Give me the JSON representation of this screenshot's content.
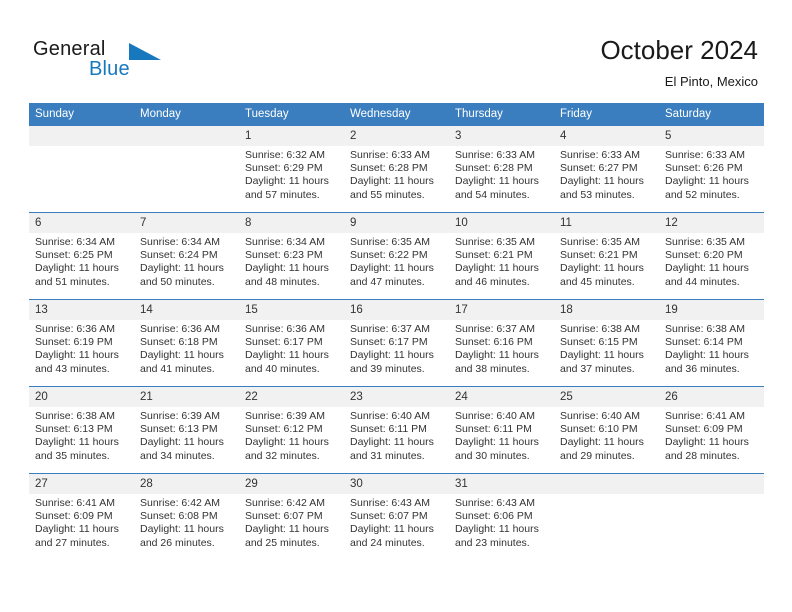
{
  "logo": {
    "word_general": "General",
    "word_blue": "Blue",
    "accent_color": "#1878be"
  },
  "header": {
    "title": "October 2024",
    "subtitle": "El Pinto, Mexico"
  },
  "calendar": {
    "header_bg": "#3a7ebf",
    "daynum_bg": "#f1f1f1",
    "weekdays": [
      "Sunday",
      "Monday",
      "Tuesday",
      "Wednesday",
      "Thursday",
      "Friday",
      "Saturday"
    ],
    "weeks": [
      [
        {
          "day": "",
          "sunrise": "",
          "sunset": "",
          "daylight_line1": "",
          "daylight_line2": ""
        },
        {
          "day": "",
          "sunrise": "",
          "sunset": "",
          "daylight_line1": "",
          "daylight_line2": ""
        },
        {
          "day": "1",
          "sunrise": "Sunrise: 6:32 AM",
          "sunset": "Sunset: 6:29 PM",
          "daylight_line1": "Daylight: 11 hours",
          "daylight_line2": "and 57 minutes."
        },
        {
          "day": "2",
          "sunrise": "Sunrise: 6:33 AM",
          "sunset": "Sunset: 6:28 PM",
          "daylight_line1": "Daylight: 11 hours",
          "daylight_line2": "and 55 minutes."
        },
        {
          "day": "3",
          "sunrise": "Sunrise: 6:33 AM",
          "sunset": "Sunset: 6:28 PM",
          "daylight_line1": "Daylight: 11 hours",
          "daylight_line2": "and 54 minutes."
        },
        {
          "day": "4",
          "sunrise": "Sunrise: 6:33 AM",
          "sunset": "Sunset: 6:27 PM",
          "daylight_line1": "Daylight: 11 hours",
          "daylight_line2": "and 53 minutes."
        },
        {
          "day": "5",
          "sunrise": "Sunrise: 6:33 AM",
          "sunset": "Sunset: 6:26 PM",
          "daylight_line1": "Daylight: 11 hours",
          "daylight_line2": "and 52 minutes."
        }
      ],
      [
        {
          "day": "6",
          "sunrise": "Sunrise: 6:34 AM",
          "sunset": "Sunset: 6:25 PM",
          "daylight_line1": "Daylight: 11 hours",
          "daylight_line2": "and 51 minutes."
        },
        {
          "day": "7",
          "sunrise": "Sunrise: 6:34 AM",
          "sunset": "Sunset: 6:24 PM",
          "daylight_line1": "Daylight: 11 hours",
          "daylight_line2": "and 50 minutes."
        },
        {
          "day": "8",
          "sunrise": "Sunrise: 6:34 AM",
          "sunset": "Sunset: 6:23 PM",
          "daylight_line1": "Daylight: 11 hours",
          "daylight_line2": "and 48 minutes."
        },
        {
          "day": "9",
          "sunrise": "Sunrise: 6:35 AM",
          "sunset": "Sunset: 6:22 PM",
          "daylight_line1": "Daylight: 11 hours",
          "daylight_line2": "and 47 minutes."
        },
        {
          "day": "10",
          "sunrise": "Sunrise: 6:35 AM",
          "sunset": "Sunset: 6:21 PM",
          "daylight_line1": "Daylight: 11 hours",
          "daylight_line2": "and 46 minutes."
        },
        {
          "day": "11",
          "sunrise": "Sunrise: 6:35 AM",
          "sunset": "Sunset: 6:21 PM",
          "daylight_line1": "Daylight: 11 hours",
          "daylight_line2": "and 45 minutes."
        },
        {
          "day": "12",
          "sunrise": "Sunrise: 6:35 AM",
          "sunset": "Sunset: 6:20 PM",
          "daylight_line1": "Daylight: 11 hours",
          "daylight_line2": "and 44 minutes."
        }
      ],
      [
        {
          "day": "13",
          "sunrise": "Sunrise: 6:36 AM",
          "sunset": "Sunset: 6:19 PM",
          "daylight_line1": "Daylight: 11 hours",
          "daylight_line2": "and 43 minutes."
        },
        {
          "day": "14",
          "sunrise": "Sunrise: 6:36 AM",
          "sunset": "Sunset: 6:18 PM",
          "daylight_line1": "Daylight: 11 hours",
          "daylight_line2": "and 41 minutes."
        },
        {
          "day": "15",
          "sunrise": "Sunrise: 6:36 AM",
          "sunset": "Sunset: 6:17 PM",
          "daylight_line1": "Daylight: 11 hours",
          "daylight_line2": "and 40 minutes."
        },
        {
          "day": "16",
          "sunrise": "Sunrise: 6:37 AM",
          "sunset": "Sunset: 6:17 PM",
          "daylight_line1": "Daylight: 11 hours",
          "daylight_line2": "and 39 minutes."
        },
        {
          "day": "17",
          "sunrise": "Sunrise: 6:37 AM",
          "sunset": "Sunset: 6:16 PM",
          "daylight_line1": "Daylight: 11 hours",
          "daylight_line2": "and 38 minutes."
        },
        {
          "day": "18",
          "sunrise": "Sunrise: 6:38 AM",
          "sunset": "Sunset: 6:15 PM",
          "daylight_line1": "Daylight: 11 hours",
          "daylight_line2": "and 37 minutes."
        },
        {
          "day": "19",
          "sunrise": "Sunrise: 6:38 AM",
          "sunset": "Sunset: 6:14 PM",
          "daylight_line1": "Daylight: 11 hours",
          "daylight_line2": "and 36 minutes."
        }
      ],
      [
        {
          "day": "20",
          "sunrise": "Sunrise: 6:38 AM",
          "sunset": "Sunset: 6:13 PM",
          "daylight_line1": "Daylight: 11 hours",
          "daylight_line2": "and 35 minutes."
        },
        {
          "day": "21",
          "sunrise": "Sunrise: 6:39 AM",
          "sunset": "Sunset: 6:13 PM",
          "daylight_line1": "Daylight: 11 hours",
          "daylight_line2": "and 34 minutes."
        },
        {
          "day": "22",
          "sunrise": "Sunrise: 6:39 AM",
          "sunset": "Sunset: 6:12 PM",
          "daylight_line1": "Daylight: 11 hours",
          "daylight_line2": "and 32 minutes."
        },
        {
          "day": "23",
          "sunrise": "Sunrise: 6:40 AM",
          "sunset": "Sunset: 6:11 PM",
          "daylight_line1": "Daylight: 11 hours",
          "daylight_line2": "and 31 minutes."
        },
        {
          "day": "24",
          "sunrise": "Sunrise: 6:40 AM",
          "sunset": "Sunset: 6:11 PM",
          "daylight_line1": "Daylight: 11 hours",
          "daylight_line2": "and 30 minutes."
        },
        {
          "day": "25",
          "sunrise": "Sunrise: 6:40 AM",
          "sunset": "Sunset: 6:10 PM",
          "daylight_line1": "Daylight: 11 hours",
          "daylight_line2": "and 29 minutes."
        },
        {
          "day": "26",
          "sunrise": "Sunrise: 6:41 AM",
          "sunset": "Sunset: 6:09 PM",
          "daylight_line1": "Daylight: 11 hours",
          "daylight_line2": "and 28 minutes."
        }
      ],
      [
        {
          "day": "27",
          "sunrise": "Sunrise: 6:41 AM",
          "sunset": "Sunset: 6:09 PM",
          "daylight_line1": "Daylight: 11 hours",
          "daylight_line2": "and 27 minutes."
        },
        {
          "day": "28",
          "sunrise": "Sunrise: 6:42 AM",
          "sunset": "Sunset: 6:08 PM",
          "daylight_line1": "Daylight: 11 hours",
          "daylight_line2": "and 26 minutes."
        },
        {
          "day": "29",
          "sunrise": "Sunrise: 6:42 AM",
          "sunset": "Sunset: 6:07 PM",
          "daylight_line1": "Daylight: 11 hours",
          "daylight_line2": "and 25 minutes."
        },
        {
          "day": "30",
          "sunrise": "Sunrise: 6:43 AM",
          "sunset": "Sunset: 6:07 PM",
          "daylight_line1": "Daylight: 11 hours",
          "daylight_line2": "and 24 minutes."
        },
        {
          "day": "31",
          "sunrise": "Sunrise: 6:43 AM",
          "sunset": "Sunset: 6:06 PM",
          "daylight_line1": "Daylight: 11 hours",
          "daylight_line2": "and 23 minutes."
        },
        {
          "day": "",
          "sunrise": "",
          "sunset": "",
          "daylight_line1": "",
          "daylight_line2": ""
        },
        {
          "day": "",
          "sunrise": "",
          "sunset": "",
          "daylight_line1": "",
          "daylight_line2": ""
        }
      ]
    ]
  }
}
